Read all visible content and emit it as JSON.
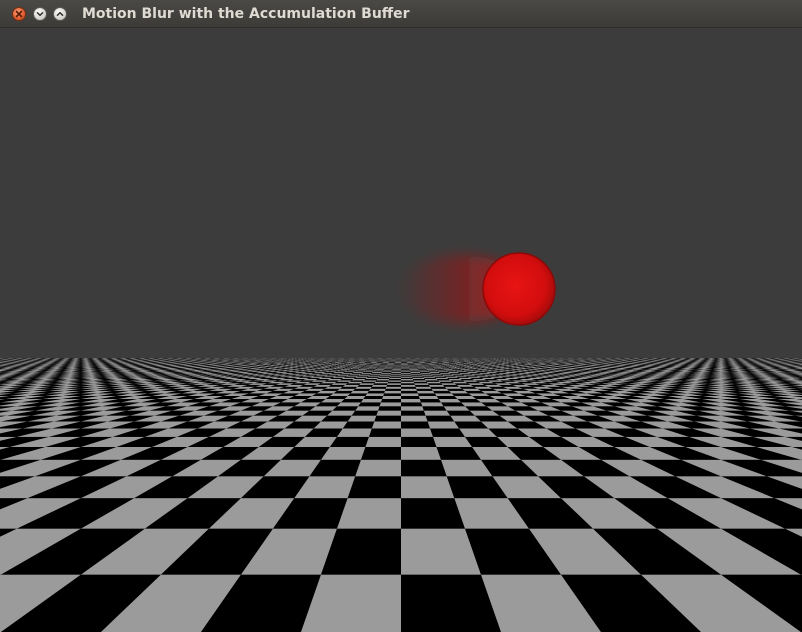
{
  "window": {
    "title": "Motion Blur with the Accumulation Buffer",
    "buttons": [
      {
        "name": "close-button",
        "icon": "close-icon",
        "color": "#e05c2c"
      },
      {
        "name": "minimize-button",
        "icon": "chevron-down-icon",
        "color": "#d6d4cf"
      },
      {
        "name": "maximize-button",
        "icon": "chevron-up-icon",
        "color": "#d6d4cf"
      }
    ]
  },
  "scene": {
    "background_color": "#3c3c3c",
    "floor_colors": [
      "#000000",
      "#9b9b9b"
    ],
    "sphere_color": "#d40d0d",
    "motion_blur": true
  }
}
